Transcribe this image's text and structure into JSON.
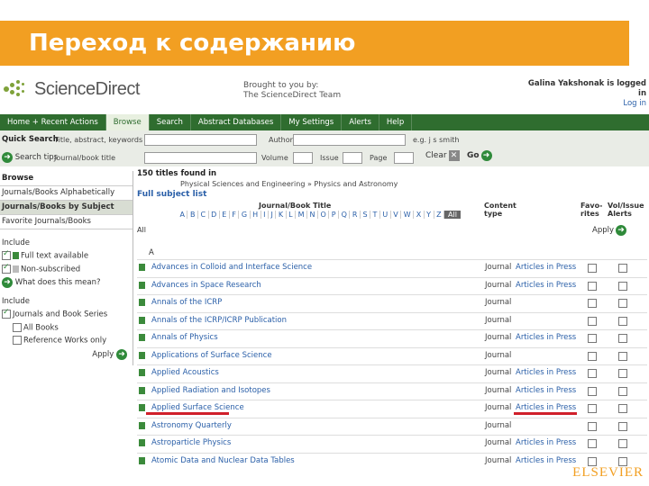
{
  "slide": {
    "title": "Переход к содержанию"
  },
  "header": {
    "logo_text": "ScienceDirect",
    "brought_line1": "Brought to you by:",
    "brought_line2": "The ScienceDirect Team",
    "user_line": "Galina Yakshonak is logged in",
    "logout": "Log in"
  },
  "nav": {
    "tabs": [
      "Home + Recent Actions",
      "Browse",
      "Search",
      "Abstract Databases",
      "My Settings",
      "Alerts",
      "Help"
    ],
    "active": "Browse"
  },
  "quick_search": {
    "label": "Quick Search",
    "tips": "Search tips",
    "title_label": "Title, abstract, keywords",
    "author_label": "Author",
    "journal_label": "Journal/book title",
    "volume_label": "Volume",
    "issue_label": "Issue",
    "page_label": "Page",
    "example": "e.g. j s smith",
    "clear": "Clear",
    "go": "Go"
  },
  "sidebar": {
    "browse_heading": "Browse",
    "items": [
      "Journals/Books Alphabetically",
      "Journals/Books by Subject",
      "Favorite Journals/Books"
    ],
    "include1_heading": "Include",
    "include1": [
      "Full text available",
      "Non-subscribed"
    ],
    "what_link": "What does this mean?",
    "include2_heading": "Include",
    "include2": [
      "Journals and Book Series",
      "All Books",
      "Reference Works only"
    ],
    "apply": "Apply"
  },
  "main": {
    "count": "150 titles found in",
    "category1": "Physical Sciences and Engineering » Physics and Astronomy",
    "full_list": "Full subject list",
    "col_title": "Journal/Book Title",
    "col_content": "Content type",
    "col_fav": "Favo-rites",
    "col_alerts": "Vol/Issue Alerts",
    "letters": [
      "A",
      "B",
      "C",
      "D",
      "E",
      "F",
      "G",
      "H",
      "I",
      "J",
      "K",
      "L",
      "M",
      "N",
      "O",
      "P",
      "Q",
      "R",
      "S",
      "T",
      "U",
      "V",
      "W",
      "X",
      "Y",
      "Z"
    ],
    "all_btn": "All",
    "all_label": "All",
    "apply": "Apply",
    "section": "A",
    "rows": [
      {
        "title": "Advances in Colloid and Interface Science",
        "type": "Journal",
        "press": "Articles in Press"
      },
      {
        "title": "Advances in Space Research",
        "type": "Journal",
        "press": "Articles in Press"
      },
      {
        "title": "Annals of the ICRP",
        "type": "Journal",
        "press": ""
      },
      {
        "title": "Annals of the ICRP/ICRP Publication",
        "type": "Journal",
        "press": ""
      },
      {
        "title": "Annals of Physics",
        "type": "Journal",
        "press": "Articles in Press"
      },
      {
        "title": "Applications of Surface Science",
        "type": "Journal",
        "press": ""
      },
      {
        "title": "Applied Acoustics",
        "type": "Journal",
        "press": "Articles in Press"
      },
      {
        "title": "Applied Radiation and Isotopes",
        "type": "Journal",
        "press": "Articles in Press"
      },
      {
        "title": "Applied Surface Science",
        "type": "Journal",
        "press": "Articles in Press"
      },
      {
        "title": "Astronomy Quarterly",
        "type": "Journal",
        "press": ""
      },
      {
        "title": "Astroparticle Physics",
        "type": "Journal",
        "press": "Articles in Press"
      },
      {
        "title": "Atomic Data and Nuclear Data Tables",
        "type": "Journal",
        "press": "Articles in Press"
      }
    ]
  },
  "footer_logo": "ELSEVIER",
  "colors": {
    "accent": "#f29f22",
    "nav": "#2f6d2f",
    "link": "#2a5fa8",
    "highlight": "#d0202a"
  }
}
